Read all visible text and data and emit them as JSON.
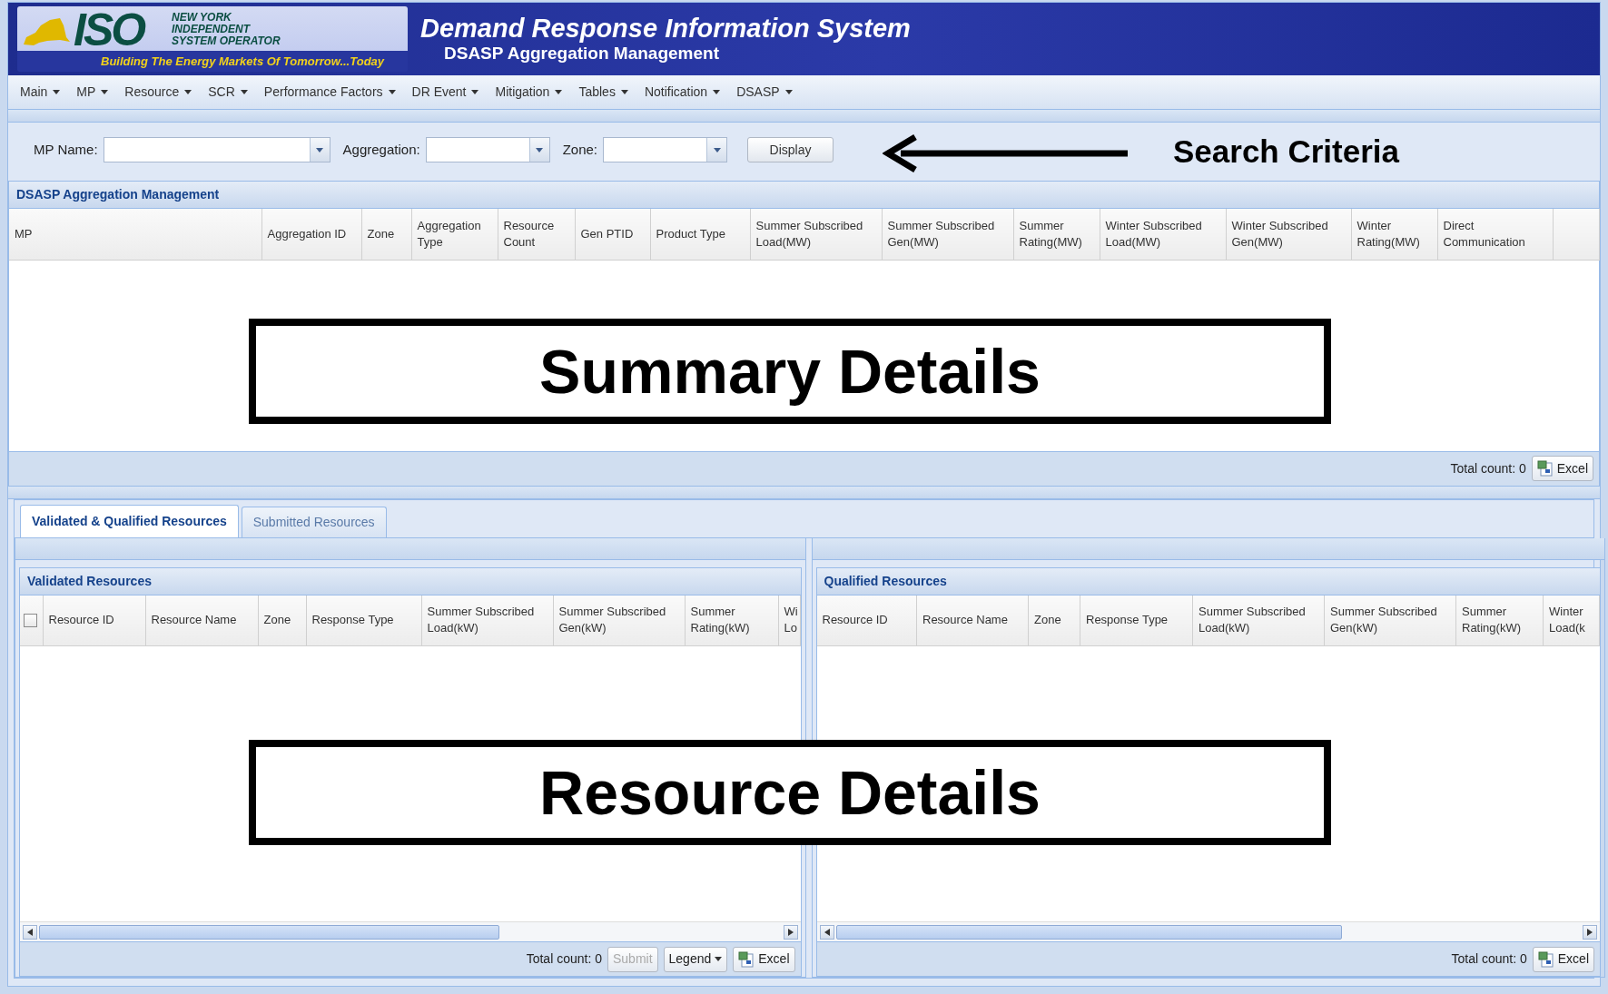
{
  "header": {
    "logo": {
      "letters": "ISO",
      "name_lines": [
        "NEW YORK",
        "INDEPENDENT",
        "SYSTEM OPERATOR"
      ],
      "tagline": "Building The Energy Markets Of Tomorrow...Today"
    },
    "title": "Demand Response Information System",
    "subtitle": "DSASP Aggregation Management"
  },
  "menu": [
    "Main",
    "MP",
    "Resource",
    "SCR",
    "Performance Factors",
    "DR Event",
    "Mitigation",
    "Tables",
    "Notification",
    "DSASP"
  ],
  "search": {
    "fields": [
      {
        "label": "MP Name:"
      },
      {
        "label": "Aggregation:"
      },
      {
        "label": "Zone:"
      }
    ],
    "button": "Display"
  },
  "summary_grid": {
    "title": "DSASP Aggregation Management",
    "columns": [
      "MP",
      "Aggregation ID",
      "Zone",
      "Aggregation Type",
      "Resource Count",
      "Gen PTID",
      "Product Type",
      "Summer Subscribed Load(MW)",
      "Summer Subscribed Gen(MW)",
      "Summer Rating(MW)",
      "Winter Subscribed Load(MW)",
      "Winter Subscribed Gen(MW)",
      "Winter Rating(MW)",
      "Direct Communication"
    ],
    "total_count": "Total count: 0",
    "export_button": "Excel"
  },
  "tabs": [
    {
      "label": "Validated & Qualified Resources",
      "selected": true
    },
    {
      "label": "Submitted Resources",
      "selected": false
    }
  ],
  "panels": [
    {
      "title": "Validated Resources",
      "select_all_checked": false,
      "columns": [
        "Resource ID",
        "Resource Name",
        "Zone",
        "Response Type",
        "Summer Subscribed Load(kW)",
        "Summer Subscribed Gen(kW)",
        "Summer Rating(kW)",
        "Wi Lo"
      ],
      "total_count": "Total count: 0",
      "buttons": [
        {
          "kind": "plain",
          "label": "Submit",
          "disabled": true
        },
        {
          "kind": "menu",
          "label": "Legend",
          "disabled": false
        },
        {
          "kind": "export",
          "label": "Excel",
          "disabled": false
        }
      ]
    },
    {
      "title": "Qualified Resources",
      "columns": [
        "Resource ID",
        "Resource Name",
        "Zone",
        "Response Type",
        "Summer Subscribed Load(kW)",
        "Summer Subscribed Gen(kW)",
        "Summer Rating(kW)",
        "Winter Load(k"
      ],
      "total_count": "Total count: 0",
      "buttons": [
        {
          "kind": "export",
          "label": "Excel",
          "disabled": false
        }
      ]
    }
  ],
  "annotations": [
    {
      "kind": "arrow",
      "text": "Search Criteria"
    },
    {
      "kind": "box",
      "text": "Summary Details"
    },
    {
      "kind": "box",
      "text": "Resource Details"
    }
  ]
}
